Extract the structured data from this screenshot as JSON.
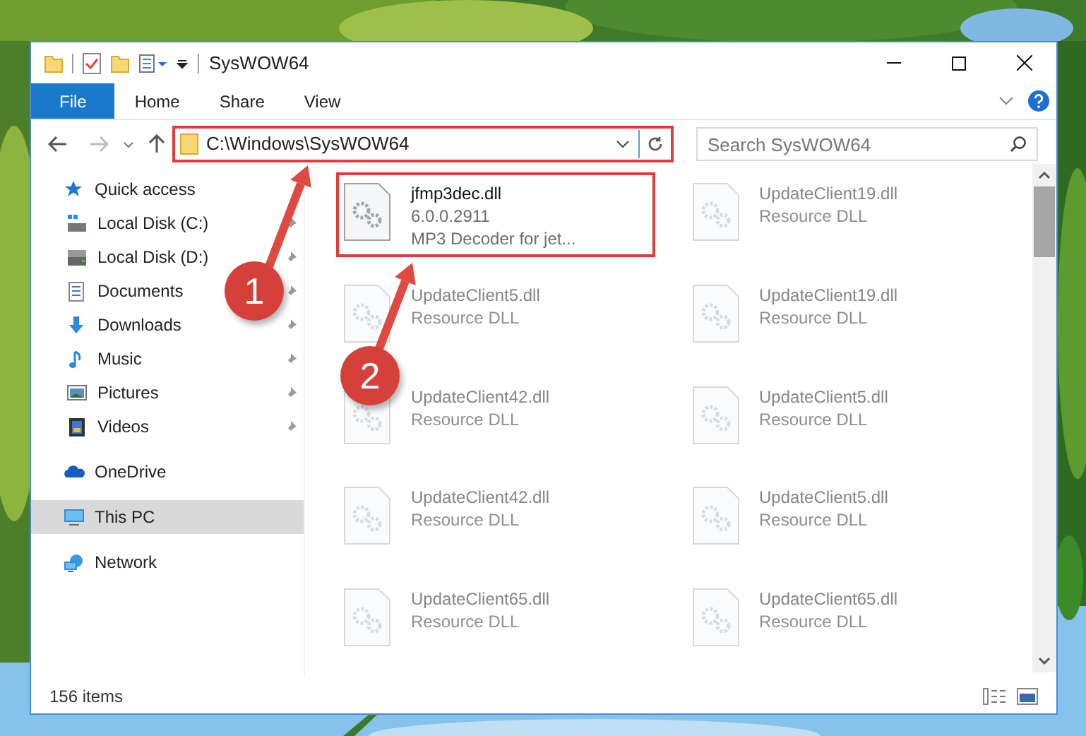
{
  "window": {
    "title": "SysWOW64"
  },
  "ribbon_tabs": [
    {
      "label": "File",
      "selected": true
    },
    {
      "label": "Home",
      "selected": false
    },
    {
      "label": "Share",
      "selected": false
    },
    {
      "label": "View",
      "selected": false
    }
  ],
  "address": {
    "path": "C:\\Windows\\SysWOW64",
    "highlighted": true
  },
  "search": {
    "placeholder": "Search SysWOW64"
  },
  "nav": [
    {
      "label": "Quick access",
      "kind": "star",
      "selected": false,
      "children": [
        {
          "label": "Local Disk (C:)",
          "kind": "system-drive",
          "pinned": true,
          "selected": false
        },
        {
          "label": "Local Disk (D:)",
          "kind": "drive",
          "pinned": true,
          "selected": false
        },
        {
          "label": "Documents",
          "kind": "documents",
          "pinned": true,
          "selected": false
        },
        {
          "label": "Downloads",
          "kind": "downloads",
          "pinned": true,
          "selected": false
        },
        {
          "label": "Music",
          "kind": "music",
          "pinned": true,
          "selected": false
        },
        {
          "label": "Pictures",
          "kind": "pictures",
          "pinned": true,
          "selected": false
        },
        {
          "label": "Videos",
          "kind": "videos",
          "pinned": true,
          "selected": false
        }
      ]
    },
    {
      "label": "OneDrive",
      "kind": "cloud",
      "selected": false
    },
    {
      "label": "This PC",
      "kind": "pc",
      "selected": true
    },
    {
      "label": "Network",
      "kind": "network",
      "selected": false
    }
  ],
  "files": [
    {
      "name": "jfmp3dec.dll",
      "details": [
        "6.0.0.2911",
        "MP3 Decoder for jet..."
      ],
      "highlighted": true
    },
    {
      "name": "UpdateClient5.dll",
      "details": [
        "Resource DLL"
      ],
      "highlighted": false
    },
    {
      "name": "UpdateClient42.dll",
      "details": [
        "Resource DLL"
      ],
      "highlighted": false
    },
    {
      "name": "UpdateClient42.dll",
      "details": [
        "Resource DLL"
      ],
      "highlighted": false
    },
    {
      "name": "UpdateClient65.dll",
      "details": [
        "Resource DLL"
      ],
      "highlighted": false
    },
    {
      "name": "UpdateClient19.dll",
      "details": [
        "Resource DLL"
      ],
      "highlighted": false
    },
    {
      "name": "UpdateClient19.dll",
      "details": [
        "Resource DLL"
      ],
      "highlighted": false
    },
    {
      "name": "UpdateClient5.dll",
      "details": [
        "Resource DLL"
      ],
      "highlighted": false
    },
    {
      "name": "UpdateClient5.dll",
      "details": [
        "Resource DLL"
      ],
      "highlighted": false
    },
    {
      "name": "UpdateClient65.dll",
      "details": [
        "Resource DLL"
      ],
      "highlighted": false
    }
  ],
  "annotations": [
    {
      "label": "1"
    },
    {
      "label": "2"
    }
  ],
  "status_bar": {
    "count": "156 items"
  }
}
